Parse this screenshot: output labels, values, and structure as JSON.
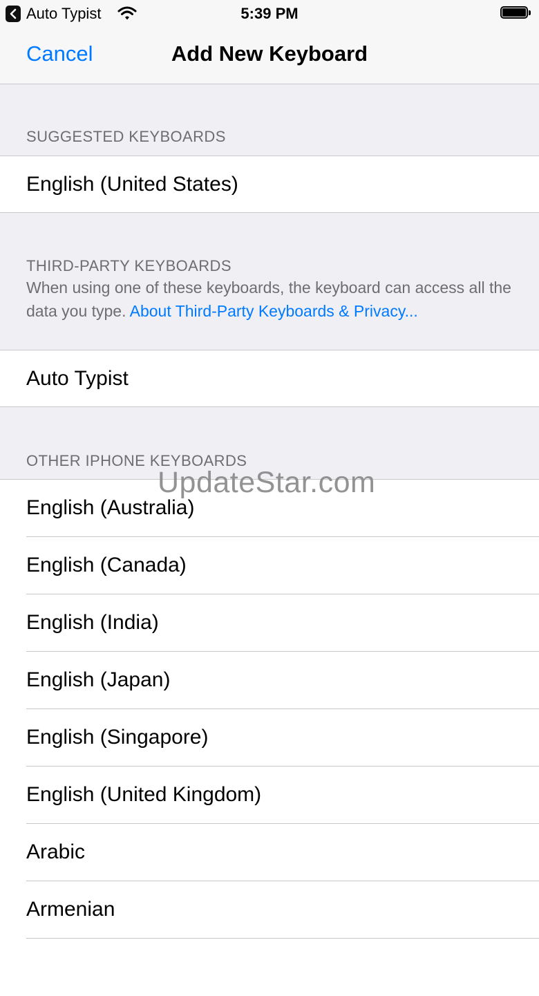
{
  "status_bar": {
    "back_app_name": "Auto Typist",
    "time": "5:39 PM",
    "icons": [
      "back-arrow-icon",
      "wifi-icon",
      "battery-icon"
    ]
  },
  "nav": {
    "cancel_label": "Cancel",
    "title": "Add New Keyboard"
  },
  "suggested": {
    "header": "SUGGESTED KEYBOARDS",
    "items": [
      "English (United States)"
    ]
  },
  "third_party": {
    "header": "THIRD-PARTY KEYBOARDS",
    "note_text": "When using one of these keyboards, the keyboard can access all the data you type. ",
    "note_link": "About Third-Party Keyboards & Privacy...",
    "items": [
      "Auto Typist"
    ]
  },
  "other": {
    "header": "OTHER IPHONE KEYBOARDS",
    "items": [
      "English (Australia)",
      "English (Canada)",
      "English (India)",
      "English (Japan)",
      "English (Singapore)",
      "English (United Kingdom)",
      "Arabic",
      "Armenian"
    ]
  },
  "watermark": "UpdateStar.com",
  "colors": {
    "accent": "#007aff",
    "background": "#efeff4",
    "secondary_text": "#6d6d72",
    "separator": "#c8c7cc"
  }
}
